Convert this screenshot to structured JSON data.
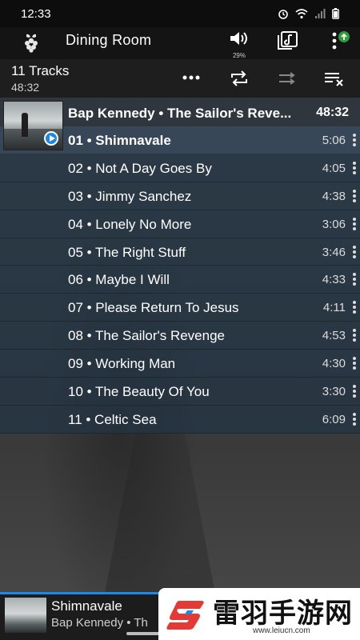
{
  "status_bar": {
    "time": "12:33"
  },
  "app_bar": {
    "title": "Dining Room",
    "volume_percent": "29%"
  },
  "summary": {
    "track_count": "11 Tracks",
    "total_duration": "48:32"
  },
  "album": {
    "info": "Bap Kennedy • The Sailor's Reve...",
    "total": "48:32"
  },
  "tracks": [
    {
      "label": "01 • Shimnavale",
      "time": "5:06",
      "current": true
    },
    {
      "label": "02 • Not A Day Goes By",
      "time": "4:05"
    },
    {
      "label": "03 • Jimmy Sanchez",
      "time": "4:38"
    },
    {
      "label": "04 • Lonely No More",
      "time": "3:06"
    },
    {
      "label": "05 • The Right Stuff",
      "time": "3:46"
    },
    {
      "label": "06 • Maybe I Will",
      "time": "4:33"
    },
    {
      "label": "07 • Please Return To Jesus",
      "time": "4:11"
    },
    {
      "label": "08 • The Sailor's Revenge",
      "time": "4:53"
    },
    {
      "label": "09 • Working Man",
      "time": "4:30"
    },
    {
      "label": "10 • The Beauty Of You",
      "time": "3:30"
    },
    {
      "label": "11 • Celtic Sea",
      "time": "6:09"
    }
  ],
  "mini_player": {
    "song": "Shimnavale",
    "artist": "Bap Kennedy • Th"
  },
  "watermark": {
    "text": "雷羽手游网",
    "url": "www.leiucn.com"
  },
  "colors": {
    "accent": "#1e88e5",
    "row": "#243444",
    "current_row": "#364658"
  },
  "icons": [
    "raspberry-pi-icon",
    "volume-icon",
    "queue-icon",
    "more-vert-icon",
    "repeat-icon",
    "shuffle-icon",
    "clear-queue-icon",
    "play-icon"
  ]
}
